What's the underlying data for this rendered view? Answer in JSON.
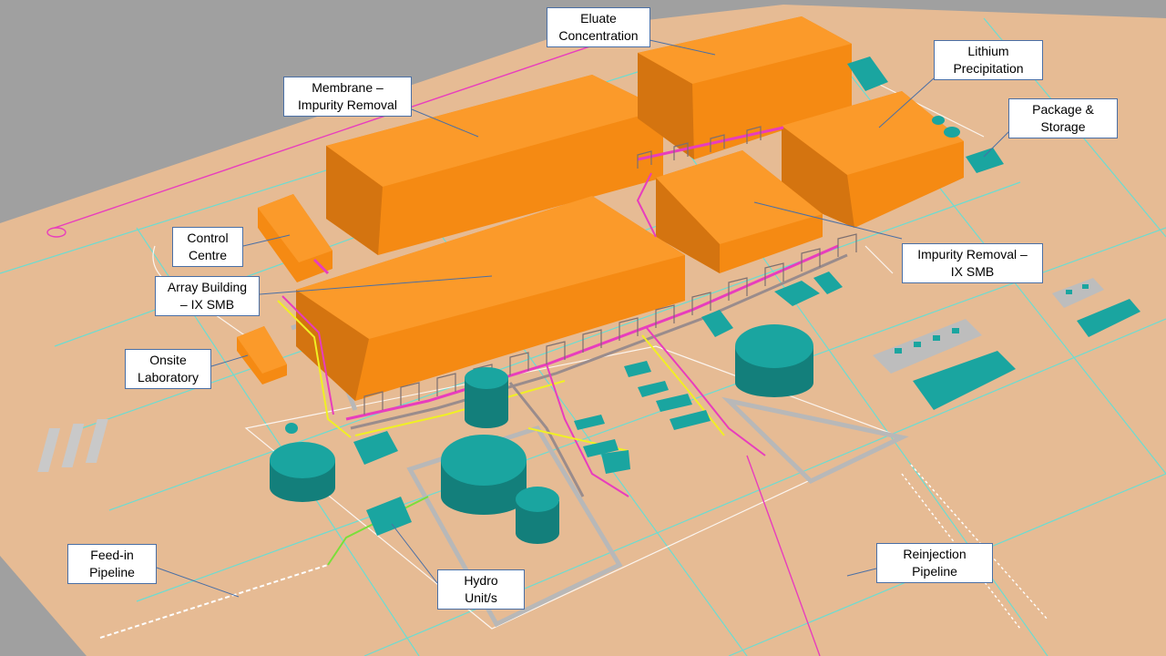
{
  "image": {
    "description_free": true,
    "colors": {
      "background": "#9a9a9a",
      "ground": "#e6bb94",
      "building": "#f58a13",
      "building_side": "#c56808",
      "building_top": "#fb9a2a",
      "equipment": "#1aa5a0",
      "equipment_dark": "#137f7b",
      "pipe_magenta": "#e83dbd",
      "pipe_yellow": "#f0f024",
      "grid_line": "#5fe0d8",
      "road_line": "#ffffff",
      "callout_border": "#4a6fa5",
      "leader_line": "#4a6fa5"
    }
  },
  "labels": {
    "eluate": {
      "line1": "Eluate",
      "line2": "Concentration"
    },
    "lithium": {
      "line1": "Lithium",
      "line2": "Precipitation"
    },
    "membrane": {
      "line1": "Membrane –",
      "line2": "Impurity Removal"
    },
    "package": {
      "line1": "Package &",
      "line2": "Storage"
    },
    "control": {
      "line1": "Control",
      "line2": "Centre"
    },
    "impurity": {
      "line1": "Impurity Removal –",
      "line2": "IX SMB"
    },
    "array": {
      "line1": "Array Building",
      "line2": "– IX SMB"
    },
    "lab": {
      "line1": "Onsite",
      "line2": "Laboratory"
    },
    "feed": {
      "line1": "Feed-in",
      "line2": "Pipeline"
    },
    "reinjection": {
      "line1": "Reinjection",
      "line2": "Pipeline"
    },
    "hydro": {
      "line1": "Hydro",
      "line2": "Unit/s"
    }
  }
}
